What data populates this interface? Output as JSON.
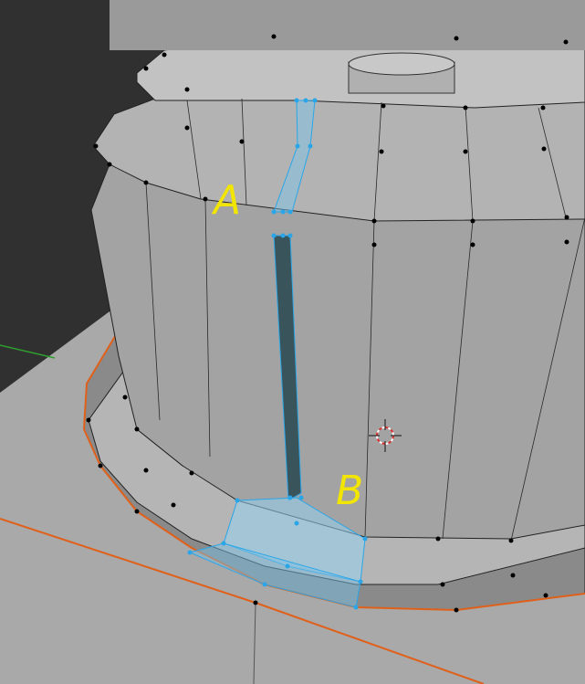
{
  "viewport": {
    "colors": {
      "background": "#303030",
      "floor": "#a8a8a8",
      "mesh_face": "#9c9c9c",
      "edge": "#1a1a1a",
      "vertex": "#000000",
      "selected_vertex": "#2aa6e8",
      "selected_face": "rgba(120,200,240,0.45)",
      "outline": "#e0601a",
      "x_axis": "#2e9e2e",
      "annotation": "#f2e600"
    },
    "annotations": {
      "a": "A",
      "b": "B"
    },
    "cursor_icon": "3d-cursor-icon"
  }
}
